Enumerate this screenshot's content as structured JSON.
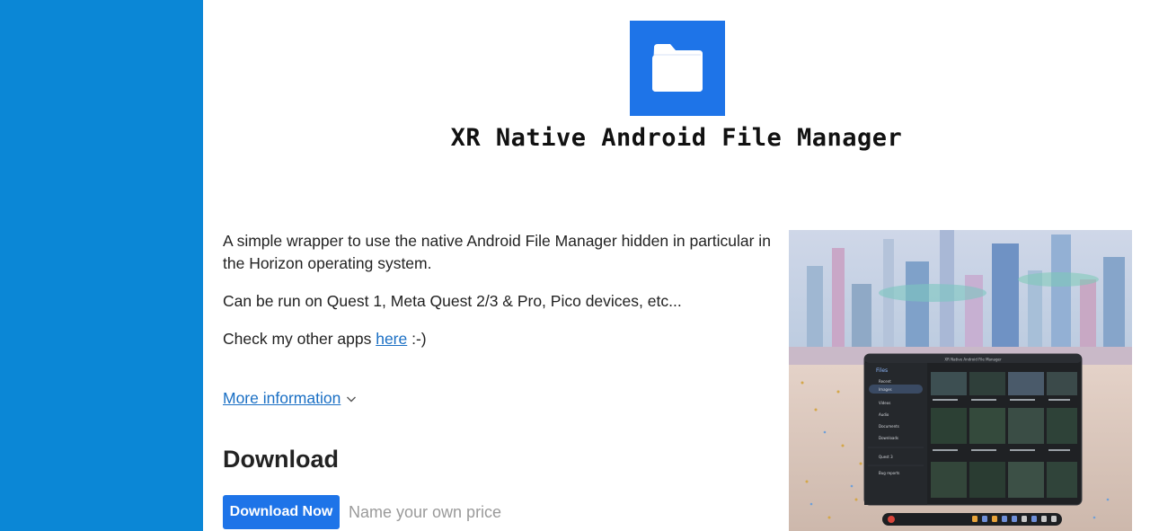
{
  "colors": {
    "rail": "#0b87d6",
    "accent": "#1e74e8",
    "link": "#1a6fc4"
  },
  "header": {
    "app_icon": "folder-icon",
    "title": "XR Native Android File Manager"
  },
  "description": {
    "line1": "A simple wrapper to use the native Android File Manager hidden in particular in the Horizon operating system.",
    "line2": "Can be run on Quest 1, Meta Quest 2/3 & Pro, Pico devices, etc...",
    "line3_prefix": "Check my other apps ",
    "line3_link": "here",
    "line3_suffix": " :-)"
  },
  "more_info": {
    "label": "More information",
    "icon": "chevron-down-icon"
  },
  "download": {
    "heading": "Download",
    "button_label": "Download Now",
    "price_hint": "Name your own price"
  },
  "screenshot": {
    "window_title": "XR Native Android File Manager",
    "app_name": "Files",
    "nav": [
      "Recent",
      "Images",
      "Videos",
      "Audio",
      "Documents",
      "Downloads",
      "Quest 3",
      "Bug reports"
    ]
  }
}
